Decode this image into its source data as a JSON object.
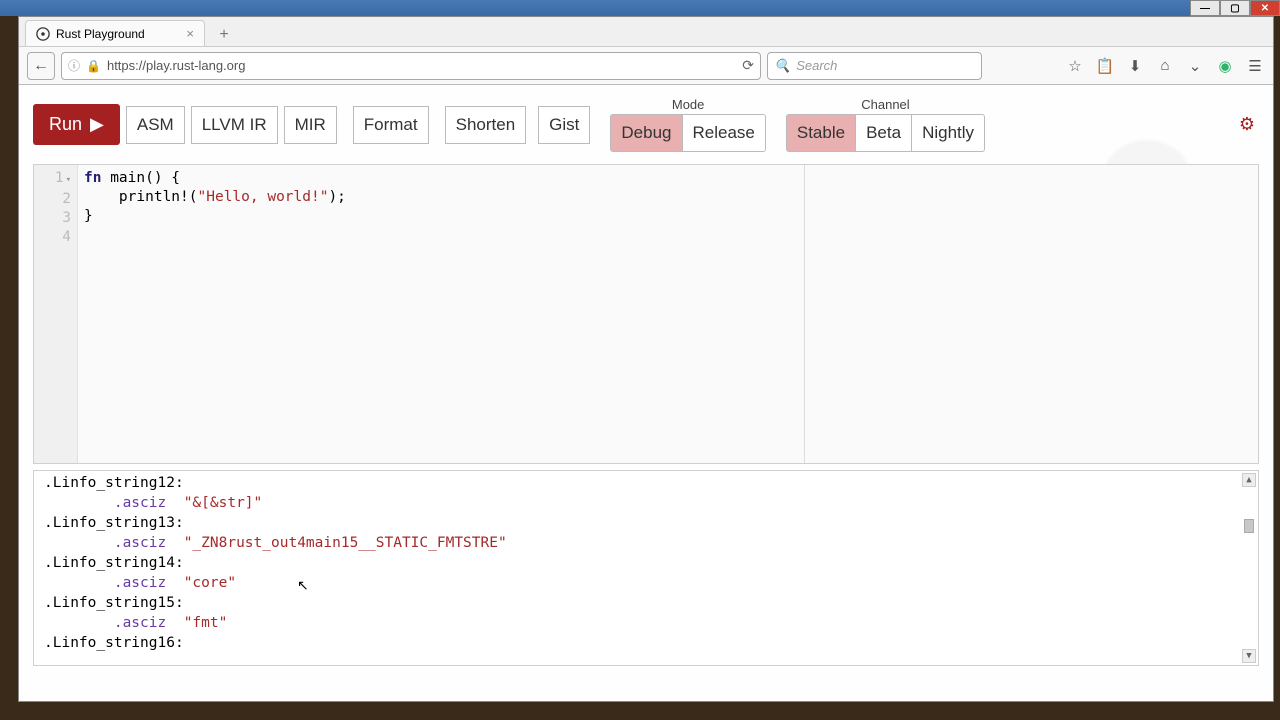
{
  "window": {
    "tab_title": "Rust Playground",
    "url": "https://play.rust-lang.org"
  },
  "search": {
    "placeholder": "Search"
  },
  "toolbar": {
    "run": "Run",
    "asm": "ASM",
    "llvmir": "LLVM IR",
    "mir": "MIR",
    "format": "Format",
    "shorten": "Shorten",
    "gist": "Gist",
    "mode_label": "Mode",
    "mode": {
      "debug": "Debug",
      "release": "Release"
    },
    "channel_label": "Channel",
    "channel": {
      "stable": "Stable",
      "beta": "Beta",
      "nightly": "Nightly"
    }
  },
  "editor": {
    "lines": [
      "1",
      "2",
      "3",
      "4"
    ],
    "code": {
      "l1_kw": "fn",
      "l1_rest": " main() {",
      "l2_pre": "    println!(",
      "l2_str": "\"Hello, world!\"",
      "l2_post": ");",
      "l3": "}",
      "l4": ""
    }
  },
  "output": {
    "rows": [
      {
        "label": ".Linfo_string12:",
        "dir": ".asciz",
        "val": "\"&[&str]\""
      },
      {
        "label": ".Linfo_string13:",
        "dir": ".asciz",
        "val": "\"_ZN8rust_out4main15__STATIC_FMTSTRE\""
      },
      {
        "label": ".Linfo_string14:",
        "dir": ".asciz",
        "val": "\"core\""
      },
      {
        "label": ".Linfo_string15:",
        "dir": ".asciz",
        "val": "\"fmt\""
      },
      {
        "label": ".Linfo_string16:",
        "dir": "",
        "val": ""
      }
    ]
  }
}
